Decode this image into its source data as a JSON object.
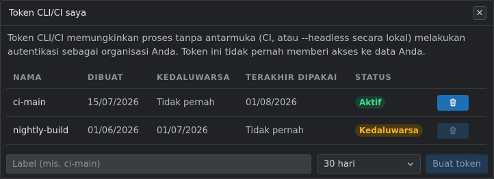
{
  "dialog": {
    "title": "Token CLI/CI saya",
    "close_icon": "close-icon",
    "description": "Token CLI/CI memungkinkan proses tanpa antarmuka (CI, atau --headless secara lokal) melakukan autentikasi sebagai organisasi Anda. Token ini tidak pernah memberi akses ke data Anda."
  },
  "table": {
    "headers": {
      "name": "NAMA",
      "created": "DIBUAT",
      "expires": "KEDALUWARSA",
      "last_used": "TERAKHIR DIPAKAI",
      "status": "STATUS"
    },
    "rows": [
      {
        "name": "ci-main",
        "created": "15/07/2026",
        "expires": "Tidak pernah",
        "last_used": "01/08/2026",
        "status": "Aktif",
        "status_color": "#3ddc8a",
        "delete_icon": "trash-icon",
        "delete_enabled": true
      },
      {
        "name": "nightly-build",
        "created": "01/06/2026",
        "expires": "01/07/2026",
        "last_used": "Tidak pernah",
        "status": "Kedaluwarsa",
        "status_color": "#f0b429",
        "delete_icon": "trash-icon",
        "delete_enabled": false
      }
    ]
  },
  "footer": {
    "label_placeholder": "Label (mis. ci-main)",
    "label_value": "",
    "expiry_selected": "30 hari",
    "expiry_icon": "chevron-down-icon",
    "create_label": "Buat token"
  },
  "colors": {
    "accent": "#1f6fb5",
    "background": "#202225"
  }
}
